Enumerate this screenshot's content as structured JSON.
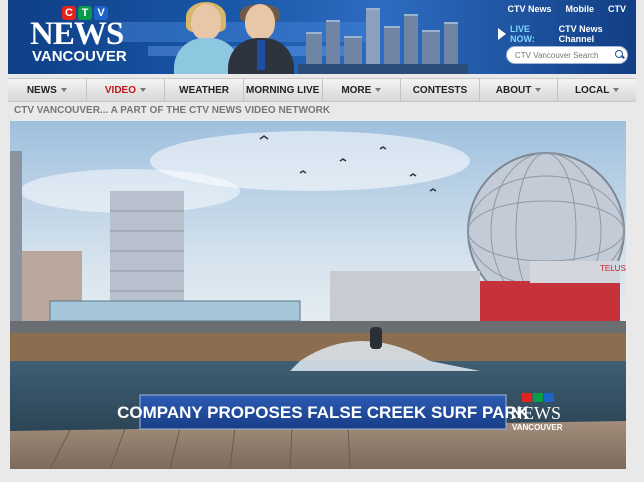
{
  "header": {
    "logo_ctv": [
      "C",
      "T",
      "V"
    ],
    "logo_news": "NEWS",
    "logo_city": "VANCOUVER",
    "top_links": [
      "CTV News",
      "Mobile",
      "CTV"
    ],
    "live_label": "LIVE NOW:",
    "live_channel": "CTV News Channel",
    "search_placeholder": "CTV Vancouver Search"
  },
  "nav": {
    "items": [
      {
        "label": "NEWS",
        "dropdown": true
      },
      {
        "label": "VIDEO",
        "dropdown": true,
        "active": true
      },
      {
        "label": "WEATHER",
        "dropdown": false
      },
      {
        "label": "MORNING LIVE",
        "dropdown": false
      },
      {
        "label": "MORE",
        "dropdown": true
      },
      {
        "label": "CONTESTS",
        "dropdown": false
      },
      {
        "label": "ABOUT",
        "dropdown": true
      },
      {
        "label": "LOCAL",
        "dropdown": true
      }
    ]
  },
  "section_subtitle": "CTV VANCOUVER... A PART OF THE CTV NEWS VIDEO NETWORK",
  "video": {
    "chyron": "COMPANY PROPOSES FALSE CREEK SURF PARK",
    "watermark_news": "NEWS",
    "watermark_city": "VANCOUVER",
    "dome_sign": "TELUS"
  },
  "colors": {
    "banner_blue": "#1957a8",
    "active_nav": "#c0161c",
    "chyron_blue": "#1b3f8c"
  }
}
